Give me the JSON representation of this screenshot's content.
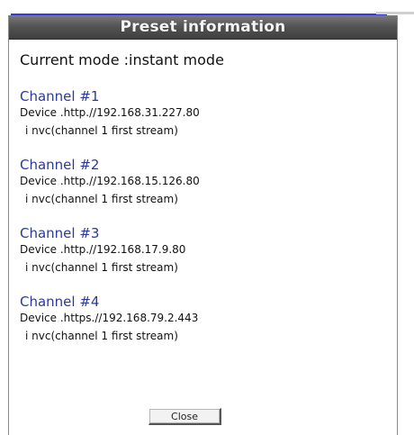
{
  "dialog": {
    "title": "Preset information",
    "mode_line": "Current mode :instant mode",
    "channels": [
      {
        "name": "Channel #1",
        "device": "Device .http.//192.168.31.227.80",
        "stream": "i nvc(channel 1   first stream)"
      },
      {
        "name": "Channel #2",
        "device": "Device .http.//192.168.15.126.80",
        "stream": "i nvc(channel 1   first stream)"
      },
      {
        "name": "Channel #3",
        "device": "Device .http.//192.168.17.9.80",
        "stream": "i nvc(channel 1   first stream)"
      },
      {
        "name": "Channel #4",
        "device": "Device .https.//192.168.79.2.443",
        "stream": "i nvc(channel 1   first stream)"
      }
    ],
    "close_label": "Close"
  },
  "colors": {
    "titlebar": "#555555",
    "channel_name": "#2a3a9a",
    "top_accent": "#3a3ad8"
  }
}
